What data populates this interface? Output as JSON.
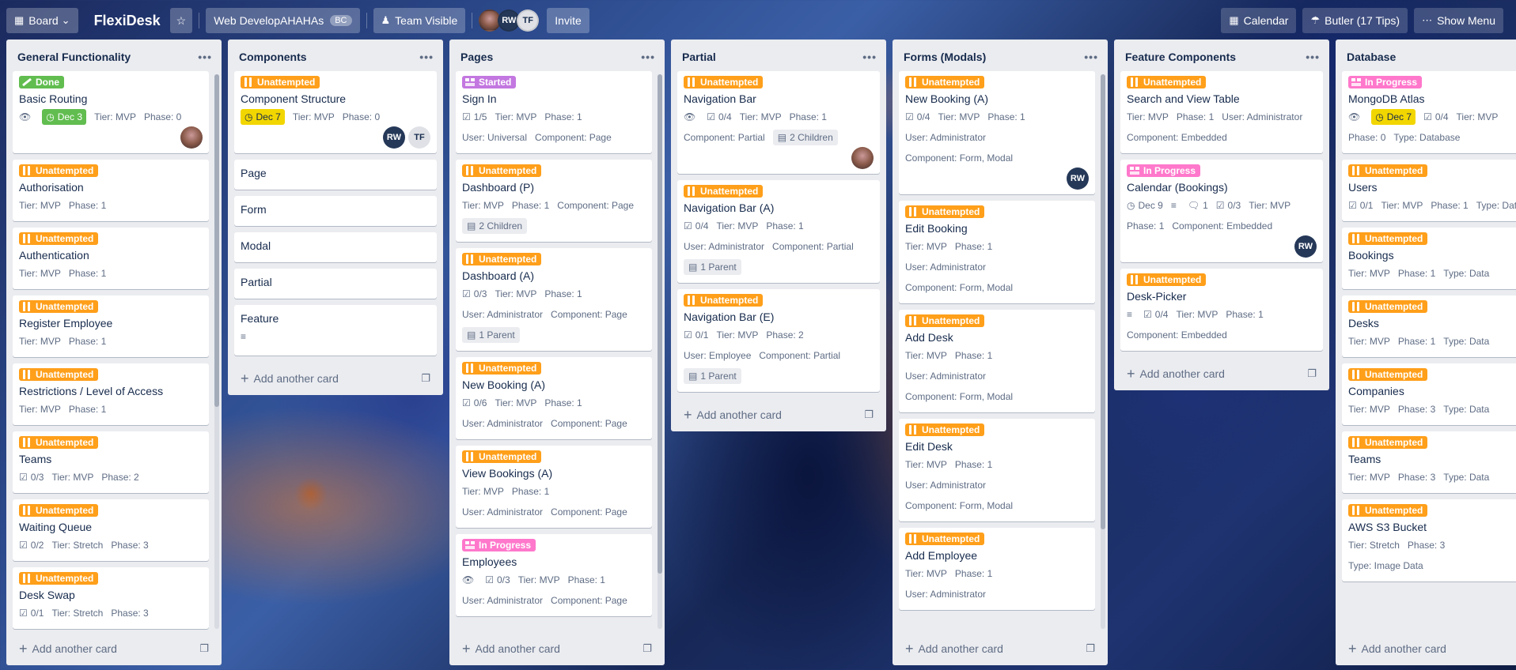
{
  "header": {
    "board_switcher": "Board",
    "board_title": "FlexiDesk",
    "workspace": "Web DevelopAHAHAs",
    "workspace_badge": "BC",
    "visibility": "Team Visible",
    "members": [
      "RW",
      "TF"
    ],
    "invite": "Invite",
    "calendar": "Calendar",
    "butler": "Butler (17 Tips)",
    "show_menu": "Show Menu"
  },
  "add_card": "Add another card",
  "colors": {
    "unattempted": "#ff9f1a",
    "done": "#61bd4f",
    "started": "#c377e0",
    "in_progress": "#ff78cb"
  },
  "lists": [
    {
      "title": "General Functionality",
      "cards": [
        {
          "label": "Done",
          "type": "done",
          "title": "Basic Routing",
          "watch": true,
          "due": "Dec 3",
          "due_color": "green",
          "tier": "Tier: MVP",
          "phase": "Phase: 0",
          "members": [
            "photo"
          ]
        },
        {
          "label": "Unattempted",
          "type": "unattempted",
          "title": "Authorisation",
          "tier": "Tier: MVP",
          "phase": "Phase: 1"
        },
        {
          "label": "Unattempted",
          "type": "unattempted",
          "title": "Authentication",
          "tier": "Tier: MVP",
          "phase": "Phase: 1"
        },
        {
          "label": "Unattempted",
          "type": "unattempted",
          "title": "Register Employee",
          "tier": "Tier: MVP",
          "phase": "Phase: 1"
        },
        {
          "label": "Unattempted",
          "type": "unattempted",
          "title": "Restrictions / Level of Access",
          "tier": "Tier: MVP",
          "phase": "Phase: 1"
        },
        {
          "label": "Unattempted",
          "type": "unattempted",
          "title": "Teams",
          "checklist": "0/3",
          "tier": "Tier: MVP",
          "phase": "Phase: 2"
        },
        {
          "label": "Unattempted",
          "type": "unattempted",
          "title": "Waiting Queue",
          "checklist": "0/2",
          "tier": "Tier: Stretch",
          "phase": "Phase: 3"
        },
        {
          "label": "Unattempted",
          "type": "unattempted",
          "title": "Desk Swap",
          "checklist": "0/1",
          "tier": "Tier: Stretch",
          "phase": "Phase: 3"
        }
      ]
    },
    {
      "title": "Components",
      "cards": [
        {
          "label": "Unattempted",
          "type": "unattempted",
          "title": "Component Structure",
          "due": "Dec 7",
          "due_color": "yellow",
          "tier": "Tier: MVP",
          "phase": "Phase: 0",
          "members": [
            "RW",
            "TF"
          ]
        },
        {
          "title": "Page",
          "simple": true
        },
        {
          "title": "Form",
          "simple": true
        },
        {
          "title": "Modal",
          "simple": true
        },
        {
          "title": "Partial",
          "simple": true
        },
        {
          "title": "Feature",
          "simple": true,
          "description": true
        }
      ]
    },
    {
      "title": "Pages",
      "cards": [
        {
          "label": "Started",
          "type": "started",
          "title": "Sign In",
          "checklist": "1/5",
          "tier": "Tier: MVP",
          "phase": "Phase: 1",
          "user": "User: Universal",
          "component": "Component: Page"
        },
        {
          "label": "Unattempted",
          "type": "unattempted",
          "title": "Dashboard (P)",
          "tier": "Tier: MVP",
          "phase": "Phase: 1",
          "component": "Component: Page",
          "chip": "2 Children"
        },
        {
          "label": "Unattempted",
          "type": "unattempted",
          "title": "Dashboard (A)",
          "checklist": "0/3",
          "tier": "Tier: MVP",
          "phase": "Phase: 1",
          "user": "User: Administrator",
          "component": "Component: Page",
          "chip": "1 Parent"
        },
        {
          "label": "Unattempted",
          "type": "unattempted",
          "title": "New Booking (A)",
          "checklist": "0/6",
          "tier": "Tier: MVP",
          "phase": "Phase: 1",
          "user": "User: Administrator",
          "component": "Component: Page"
        },
        {
          "label": "Unattempted",
          "type": "unattempted",
          "title": "View Bookings (A)",
          "tier": "Tier: MVP",
          "phase": "Phase: 1",
          "user": "User: Administrator",
          "component": "Component: Page"
        },
        {
          "label": "In Progress",
          "type": "progress",
          "title": "Employees",
          "watch": true,
          "checklist": "0/3",
          "tier": "Tier: MVP",
          "phase": "Phase: 1",
          "user": "User: Administrator",
          "component": "Component: Page"
        }
      ]
    },
    {
      "title": "Partial",
      "cards": [
        {
          "label": "Unattempted",
          "type": "unattempted",
          "title": "Navigation Bar",
          "watch": true,
          "checklist": "0/4",
          "tier": "Tier: MVP",
          "phase": "Phase: 1",
          "component": "Component: Partial",
          "chip": "2 Children",
          "members": [
            "photo"
          ]
        },
        {
          "label": "Unattempted",
          "type": "unattempted",
          "title": "Navigation Bar (A)",
          "checklist": "0/4",
          "tier": "Tier: MVP",
          "phase": "Phase: 1",
          "user": "User: Administrator",
          "component": "Component: Partial",
          "chip": "1 Parent"
        },
        {
          "label": "Unattempted",
          "type": "unattempted",
          "title": "Navigation Bar (E)",
          "checklist": "0/1",
          "tier": "Tier: MVP",
          "phase": "Phase: 2",
          "user": "User: Employee",
          "component": "Component: Partial",
          "chip": "1 Parent"
        }
      ]
    },
    {
      "title": "Forms (Modals)",
      "cards": [
        {
          "label": "Unattempted",
          "type": "unattempted",
          "title": "New Booking (A)",
          "checklist": "0/4",
          "tier": "Tier: MVP",
          "phase": "Phase: 1",
          "user": "User: Administrator",
          "component": "Component: Form, Modal",
          "members": [
            "RW"
          ]
        },
        {
          "label": "Unattempted",
          "type": "unattempted",
          "title": "Edit Booking",
          "tier": "Tier: MVP",
          "phase": "Phase: 1",
          "user": "User: Administrator",
          "component": "Component: Form, Modal"
        },
        {
          "label": "Unattempted",
          "type": "unattempted",
          "title": "Add Desk",
          "tier": "Tier: MVP",
          "phase": "Phase: 1",
          "user": "User: Administrator",
          "component": "Component: Form, Modal"
        },
        {
          "label": "Unattempted",
          "type": "unattempted",
          "title": "Edit Desk",
          "tier": "Tier: MVP",
          "phase": "Phase: 1",
          "user": "User: Administrator",
          "component": "Component: Form, Modal"
        },
        {
          "label": "Unattempted",
          "type": "unattempted",
          "title": "Add Employee",
          "tier": "Tier: MVP",
          "phase": "Phase: 1",
          "user": "User: Administrator"
        }
      ]
    },
    {
      "title": "Feature Components",
      "cards": [
        {
          "label": "Unattempted",
          "type": "unattempted",
          "title": "Search and View Table",
          "tier": "Tier: MVP",
          "phase": "Phase: 1",
          "user": "User: Administrator",
          "component": "Component: Embedded"
        },
        {
          "label": "In Progress",
          "type": "progress",
          "title": "Calendar (Bookings)",
          "date": "Dec 9",
          "description": true,
          "comments": "1",
          "checklist": "0/3",
          "tier": "Tier: MVP",
          "phase": "Phase: 1",
          "component": "Component: Embedded",
          "members": [
            "RW"
          ]
        },
        {
          "label": "Unattempted",
          "type": "unattempted",
          "title": "Desk-Picker",
          "description": true,
          "checklist": "0/4",
          "tier": "Tier: MVP",
          "phase": "Phase: 1",
          "component": "Component: Embedded"
        }
      ]
    },
    {
      "title": "Database",
      "cards": [
        {
          "label": "In Progress",
          "type": "progress",
          "title": "MongoDB Atlas",
          "watch": true,
          "due": "Dec 7",
          "due_color": "yellow",
          "checklist": "0/4",
          "tier": "Tier: MVP",
          "phase": "Phase: 0",
          "dtype": "Type: Database"
        },
        {
          "label": "Unattempted",
          "type": "unattempted",
          "title": "Users",
          "checklist": "0/1",
          "tier": "Tier: MVP",
          "phase": "Phase: 1",
          "dtype": "Type: Data"
        },
        {
          "label": "Unattempted",
          "type": "unattempted",
          "title": "Bookings",
          "tier": "Tier: MVP",
          "phase": "Phase: 1",
          "dtype": "Type: Data"
        },
        {
          "label": "Unattempted",
          "type": "unattempted",
          "title": "Desks",
          "tier": "Tier: MVP",
          "phase": "Phase: 1",
          "dtype": "Type: Data"
        },
        {
          "label": "Unattempted",
          "type": "unattempted",
          "title": "Companies",
          "tier": "Tier: MVP",
          "phase": "Phase: 3",
          "dtype": "Type: Data"
        },
        {
          "label": "Unattempted",
          "type": "unattempted",
          "title": "Teams",
          "tier": "Tier: MVP",
          "phase": "Phase: 3",
          "dtype": "Type: Data"
        },
        {
          "label": "Unattempted",
          "type": "unattempted",
          "title": "AWS S3 Bucket",
          "tier": "Tier: Stretch",
          "phase": "Phase: 3",
          "dtype": "Type: Image Data"
        }
      ]
    }
  ]
}
